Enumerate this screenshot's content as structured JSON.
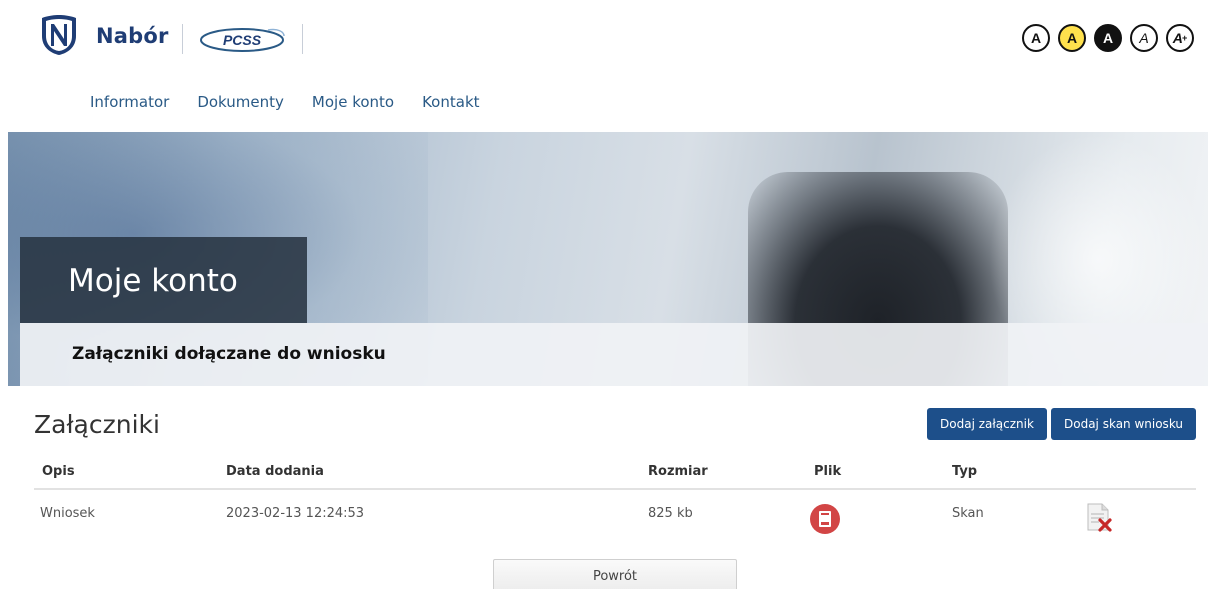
{
  "header": {
    "brand": "Nabór",
    "partner_logo_text": "PCSS",
    "a11y": [
      "A",
      "A",
      "A",
      "A",
      "A"
    ]
  },
  "nav": [
    {
      "label": "Informator"
    },
    {
      "label": "Dokumenty"
    },
    {
      "label": "Moje konto"
    },
    {
      "label": "Kontakt"
    }
  ],
  "hero": {
    "title": "Moje konto",
    "subtitle": "Załączniki dołączane do wniosku"
  },
  "attachments": {
    "title": "Załączniki",
    "add_attachment_label": "Dodaj załącznik",
    "add_scan_label": "Dodaj skan wniosku",
    "columns": [
      "Opis",
      "Data dodania",
      "Rozmiar",
      "Plik",
      "Typ"
    ],
    "rows": [
      {
        "opis": "Wniosek",
        "data": "2023-02-13 12:24:53",
        "rozmiar": "825 kb",
        "typ": "Skan"
      }
    ]
  },
  "back_label": "Powrót",
  "colors": {
    "brand": "#1f3d75",
    "nav_link": "#2a5a86",
    "button": "#1d4f8a",
    "pdf": "#d24545"
  }
}
